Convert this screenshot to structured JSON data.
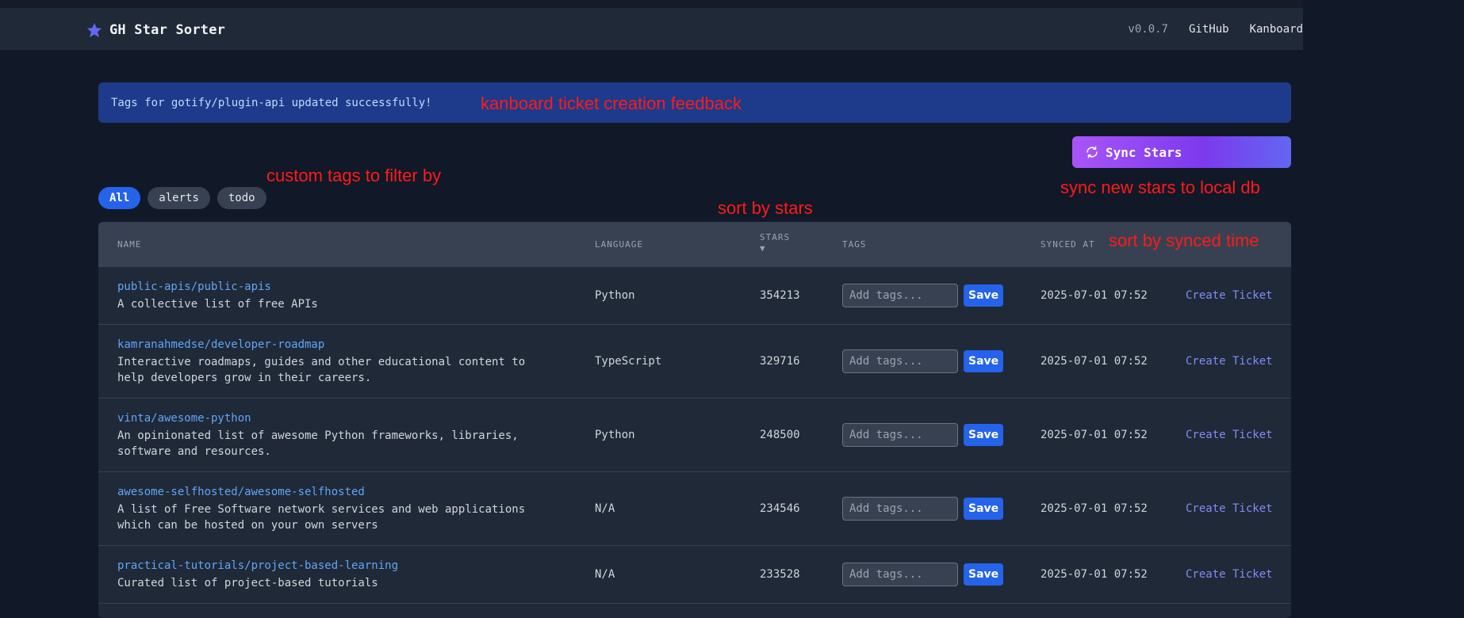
{
  "header": {
    "title": "GH Star Sorter",
    "version": "v0.0.7",
    "links": [
      "GitHub",
      "Kanboard"
    ]
  },
  "alert": {
    "message": "Tags for gotify/plugin-api updated successfully!"
  },
  "annotations": {
    "feedback": "kanboard ticket creation feedback",
    "tags": "custom tags to filter by",
    "sort_stars": "sort by stars",
    "sync": "sync new stars to local db",
    "sort_synced": "sort by synced time"
  },
  "sync_button": {
    "label": "Sync Stars"
  },
  "filters": [
    "All",
    "alerts",
    "todo"
  ],
  "table": {
    "columns": {
      "name": "NAME",
      "language": "LANGUAGE",
      "stars": "STARS",
      "stars_sort": "▼",
      "tags": "TAGS",
      "synced": "SYNCED AT"
    },
    "tag_placeholder": "Add tags...",
    "save_label": "Save",
    "ticket_label": "Create Ticket",
    "rows": [
      {
        "name": "public-apis/public-apis",
        "desc": "A collective list of free APIs",
        "language": "Python",
        "stars": "354213",
        "synced": "2025-07-01 07:52"
      },
      {
        "name": "kamranahmedse/developer-roadmap",
        "desc": "Interactive roadmaps, guides and other educational content to\nhelp developers grow in their careers.",
        "language": "TypeScript",
        "stars": "329716",
        "synced": "2025-07-01 07:52"
      },
      {
        "name": "vinta/awesome-python",
        "desc": "An opinionated list of awesome Python frameworks, libraries,\nsoftware and resources.",
        "language": "Python",
        "stars": "248500",
        "synced": "2025-07-01 07:52"
      },
      {
        "name": "awesome-selfhosted/awesome-selfhosted",
        "desc": "A list of Free Software network services and web applications\nwhich can be hosted on your own servers",
        "language": "N/A",
        "stars": "234546",
        "synced": "2025-07-01 07:52"
      },
      {
        "name": "practical-tutorials/project-based-learning",
        "desc": "Curated list of project-based tutorials",
        "language": "N/A",
        "stars": "233528",
        "synced": "2025-07-01 07:52"
      }
    ]
  }
}
